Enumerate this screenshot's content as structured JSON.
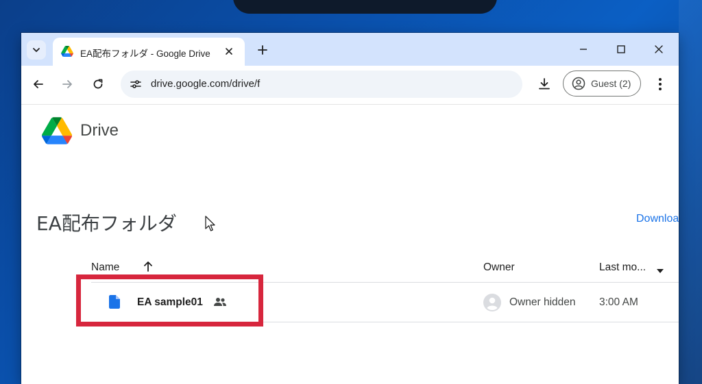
{
  "browser": {
    "tab_title": "EA配布フォルダ - Google Drive",
    "url": "drive.google.com/drive/f",
    "profile_label": "Guest (2)"
  },
  "drive": {
    "app_name": "Drive",
    "folder_title": "EA配布フォルダ",
    "download_link": "Downloa",
    "columns": {
      "name": "Name",
      "owner": "Owner",
      "last_modified": "Last mo..."
    },
    "files": [
      {
        "name": "EA sample01",
        "owner": "Owner hidden",
        "modified": "3:00 AM",
        "shared": true
      }
    ]
  },
  "colors": {
    "highlight": "#d7263d",
    "tabstrip": "#d3e3fd",
    "link": "#1a73e8"
  }
}
